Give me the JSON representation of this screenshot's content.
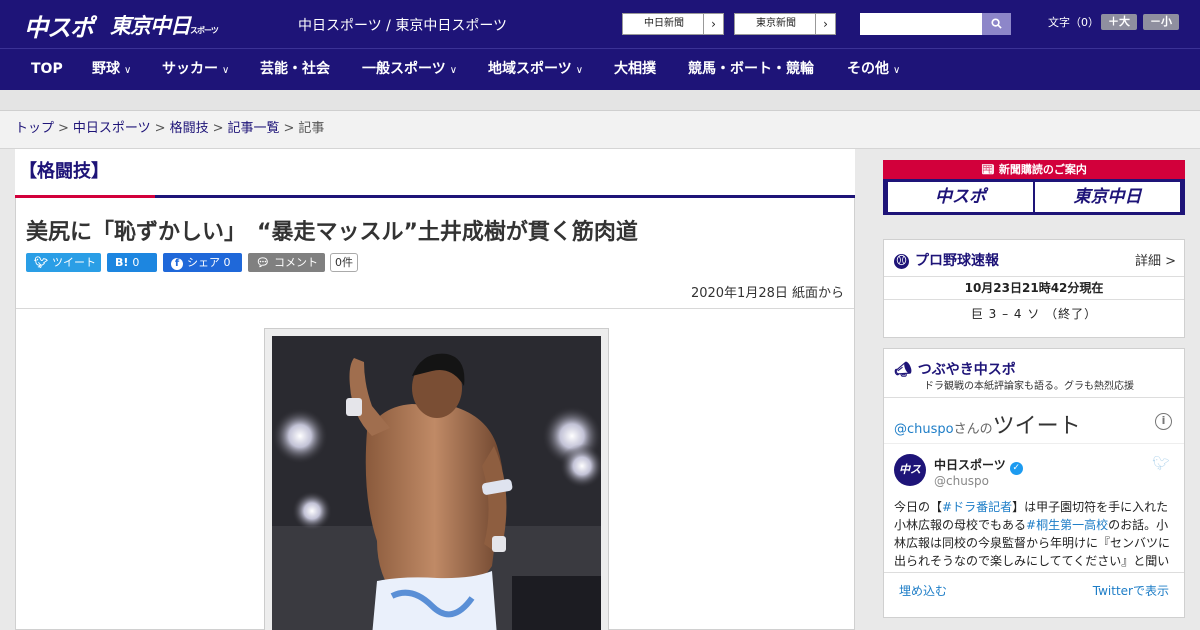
{
  "header": {
    "logo_main": "中スポ",
    "logo_tokyo": "東京中日",
    "logo_tokyo_small": "スポーツ",
    "site_title": "中日スポーツ / 東京中日スポーツ",
    "ext_links": [
      {
        "label": "中日新聞"
      },
      {
        "label": "東京新聞"
      }
    ],
    "search_placeholder": "",
    "font_label": "文字（0）",
    "font_plus": "＋大",
    "font_minus": "－小"
  },
  "nav": [
    {
      "label": "TOP",
      "has_menu": false
    },
    {
      "label": "野球",
      "has_menu": true
    },
    {
      "label": "サッカー",
      "has_menu": true
    },
    {
      "label": "芸能・社会",
      "has_menu": false
    },
    {
      "label": "一般スポーツ",
      "has_menu": true
    },
    {
      "label": "地域スポーツ",
      "has_menu": true
    },
    {
      "label": "大相撲",
      "has_menu": false
    },
    {
      "label": "競馬・ボート・競輪",
      "has_menu": false
    },
    {
      "label": "その他",
      "has_menu": true
    }
  ],
  "breadcrumb": {
    "items": [
      "トップ",
      "中日スポーツ",
      "格闘技",
      "記事一覧"
    ],
    "current": "記事",
    "separator": ">"
  },
  "category": "【格闘技】",
  "article": {
    "headline": "美尻に「恥ずかしい」　“暴走マッスル”土井成樹が貫く筋肉道",
    "share": {
      "tweet": "ツイート",
      "hatena_icon": "B!",
      "hatena_count": "0",
      "facebook": "シェア",
      "facebook_count": "0",
      "comment": "コメント",
      "comment_count": "0件"
    },
    "dateline": "2020年1月28日 紙面から"
  },
  "sidebar": {
    "subscribe": {
      "title": "新聞購読のご案内",
      "btn1": "中スポ",
      "btn2": "東京中日"
    },
    "baseball": {
      "title": "プロ野球速報",
      "more": "詳細 >",
      "timestamp": "10月23日21時42分現在",
      "score": "巨 3 – 4 ソ （終了）"
    },
    "twitter": {
      "title": "つぶやき中スポ",
      "subtitle": "ドラ観戦の本紙評論家も語る。グラも熱烈応援",
      "handle_link": "@chuspo",
      "handle_suffix": "さんの",
      "handle_big": "ツイート",
      "account_name": "中日スポーツ",
      "account_handle": "@chuspo",
      "avatar_text": "中スポ",
      "tweet_pre": "今日の【",
      "tweet_tag1": "#ドラ番記者",
      "tweet_mid1": "】は甲子園切符を手に入れた小林広報の母校でもある",
      "tweet_tag2": "#桐生第一高校",
      "tweet_rest": "のお話。小林広報は同校の今泉監督から年明けに『センバツに出られそうなので楽しみにしててください』と聞い",
      "embed": "埋め込む",
      "view_on": "Twitterで表示"
    }
  },
  "colors": {
    "brand_navy": "#1e1478",
    "accent_red": "#d2003b",
    "twitter_blue": "#2a9ee6"
  }
}
